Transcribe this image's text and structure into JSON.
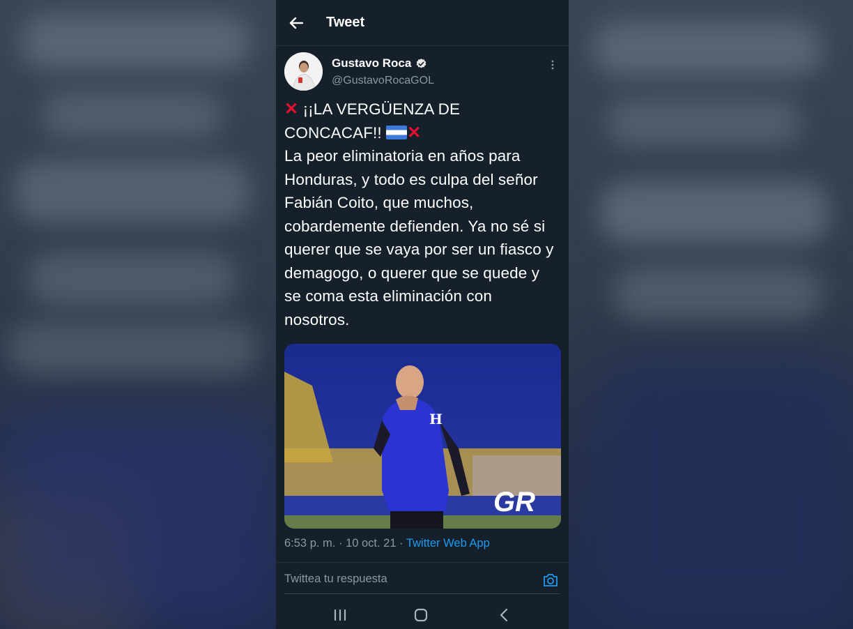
{
  "header": {
    "title": "Tweet",
    "back_icon": "arrow-left-icon"
  },
  "author": {
    "name": "Gustavo Roca",
    "handle": "@GustavoRocaGOL",
    "verified_icon": "verified-badge-icon",
    "more_icon": "more-vertical-icon"
  },
  "tweet": {
    "line1_text": "¡¡LA VERGÜENZA DE",
    "line2_text": "CONCACAF!!",
    "body": "La peor eliminatoria en años para Honduras, y todo es culpa del señor Fabián Coito, que muchos, cobardemente defienden. Ya no sé si querer que se vaya por ser un fiasco y demagogo, o querer que se quede y se coma esta eliminación con nosotros.",
    "emoji_cross": "cross-mark-icon",
    "emoji_flag": "honduras-flag-icon",
    "media_watermark": "GR"
  },
  "meta": {
    "time": "6:53 p. m.",
    "separator": "·",
    "date": "10 oct. 21",
    "source": "Twitter Web App"
  },
  "reply": {
    "placeholder": "Twittea tu respuesta",
    "camera_icon": "camera-icon"
  },
  "nav": {
    "recents_icon": "recents-icon",
    "home_icon": "home-icon",
    "back_icon": "back-chevron-icon"
  },
  "colors": {
    "background": "#15202b",
    "accent": "#1d9bf0",
    "muted": "#8899a6",
    "cross_red": "#e8112d"
  }
}
